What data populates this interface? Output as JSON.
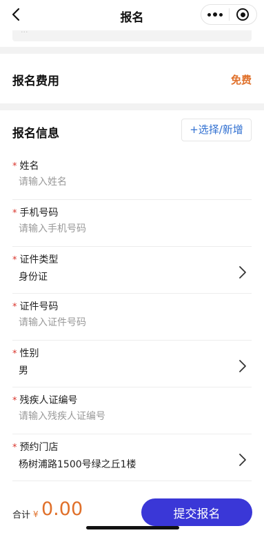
{
  "navbar": {
    "title": "报名",
    "back_icon": "chevron-left-icon",
    "more_icon": "more-dots-icon",
    "close_icon": "target-close-icon"
  },
  "address_card": {
    "partial_text": "..."
  },
  "fee": {
    "title": "报名费用",
    "value": "免费"
  },
  "info": {
    "title": "报名信息",
    "select_button": "+选择/新增",
    "fields": [
      {
        "label": "姓名",
        "required": "*",
        "placeholder": "请输入姓名",
        "value": ""
      },
      {
        "label": "手机号码",
        "required": "*",
        "placeholder": "请输入手机号码",
        "value": ""
      },
      {
        "label": "证件类型",
        "required": "*",
        "value": "身份证"
      },
      {
        "label": "证件号码",
        "required": "*",
        "placeholder": "请输入证件号码",
        "value": ""
      },
      {
        "label": "性别",
        "required": "*",
        "value": "男"
      },
      {
        "label": "残疾人证编号",
        "required": "*",
        "placeholder": "请输入残疾人证编号",
        "value": ""
      },
      {
        "label": "预约门店",
        "required": "*",
        "value": "杨树浦路1500号绿之丘1楼"
      }
    ]
  },
  "footer": {
    "total_label": "合计",
    "currency": "¥",
    "amount": "0.00",
    "submit_label": "提交报名"
  },
  "colors": {
    "accent_orange": "#e0702a",
    "primary_blue": "#3a37d7",
    "link_blue": "#2f6fd1",
    "required_red": "#d9342b"
  }
}
